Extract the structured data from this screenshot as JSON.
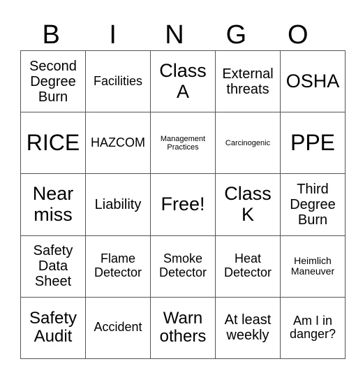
{
  "card": {
    "header": [
      "B",
      "I",
      "N",
      "G",
      "O"
    ],
    "rows": [
      [
        {
          "text": "Second Degree Burn",
          "size": "s-mdl"
        },
        {
          "text": "Facilities",
          "size": "s-md"
        },
        {
          "text": "Class A",
          "size": "s-xl"
        },
        {
          "text": "External threats",
          "size": "s-mdl"
        },
        {
          "text": "OSHA",
          "size": "s-xl"
        }
      ],
      [
        {
          "text": "RICE",
          "size": "s-xxl"
        },
        {
          "text": "HAZCOM",
          "size": "s-md"
        },
        {
          "text": "Management Practices",
          "size": "s-xs"
        },
        {
          "text": "Carcinogenic",
          "size": "s-xs"
        },
        {
          "text": "PPE",
          "size": "s-xxl"
        }
      ],
      [
        {
          "text": "Near miss",
          "size": "s-xl"
        },
        {
          "text": "Liability",
          "size": "s-mdl"
        },
        {
          "text": "Free!",
          "size": "s-xl"
        },
        {
          "text": "Class K",
          "size": "s-xl"
        },
        {
          "text": "Third Degree Burn",
          "size": "s-mdl"
        }
      ],
      [
        {
          "text": "Safety Data Sheet",
          "size": "s-mdl"
        },
        {
          "text": "Flame Detector",
          "size": "s-md"
        },
        {
          "text": "Smoke Detector",
          "size": "s-md"
        },
        {
          "text": "Heat Detector",
          "size": "s-md"
        },
        {
          "text": "Heimlich Maneuver",
          "size": "s-sm"
        }
      ],
      [
        {
          "text": "Safety Audit",
          "size": "s-lg"
        },
        {
          "text": "Accident",
          "size": "s-md"
        },
        {
          "text": "Warn others",
          "size": "s-lg"
        },
        {
          "text": "At least weekly",
          "size": "s-mdl"
        },
        {
          "text": "Am I in danger?",
          "size": "s-md"
        }
      ]
    ]
  }
}
